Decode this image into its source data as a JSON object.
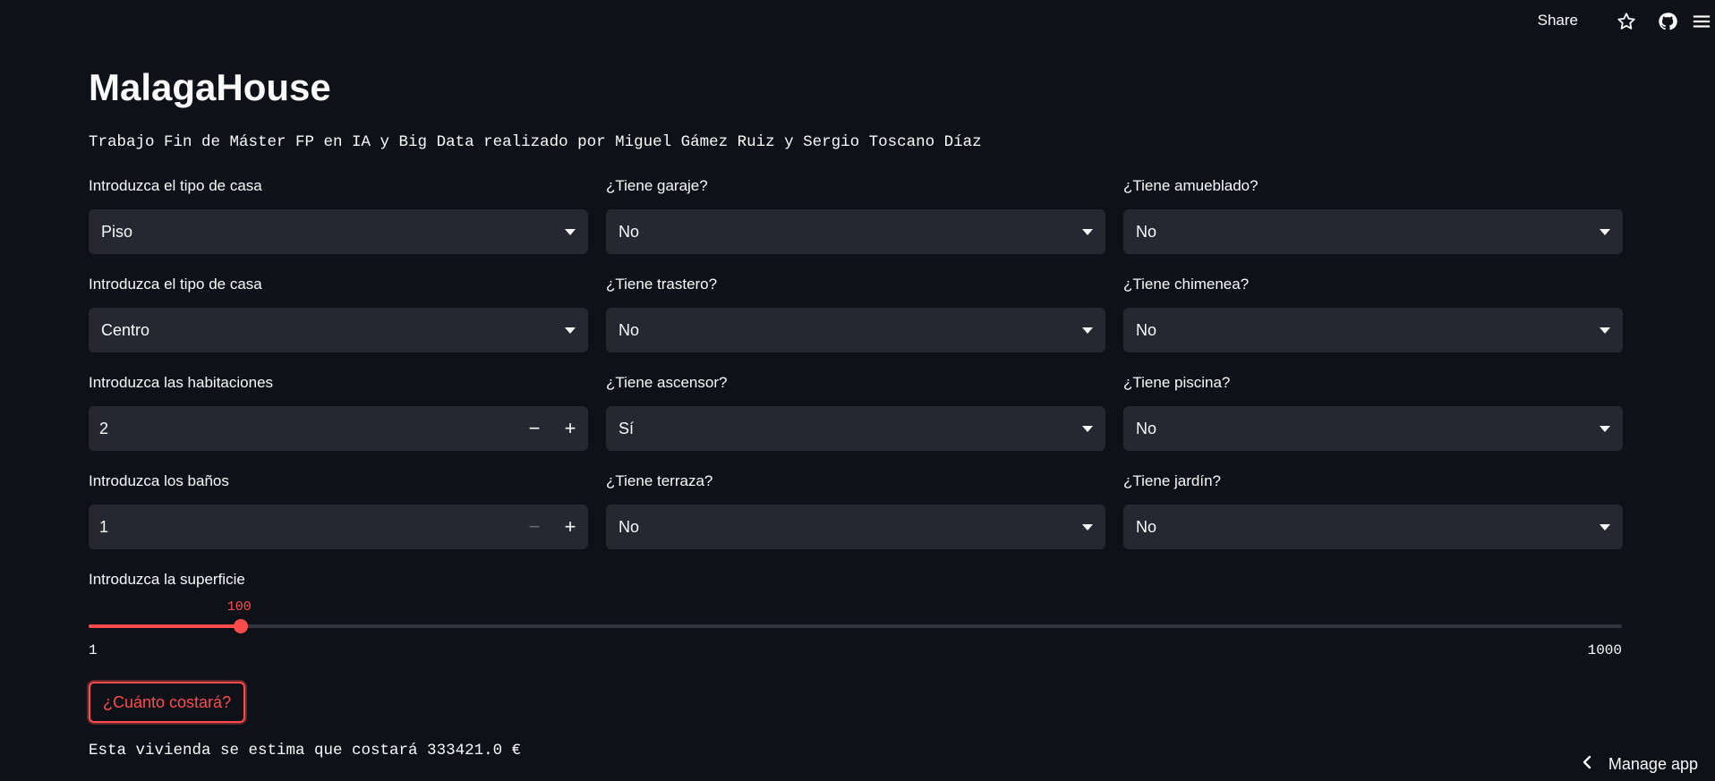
{
  "header": {
    "share_label": "Share",
    "icons": [
      "star-icon",
      "github-icon",
      "menu-icon"
    ]
  },
  "title": "MalagaHouse",
  "subtitle": "Trabajo Fin de Máster FP en IA y Big Data realizado por Miguel Gámez Ruiz y Sergio Toscano Díaz",
  "col1": {
    "tipo_casa": {
      "label": "Introduzca el tipo de casa",
      "value": "Piso"
    },
    "zona": {
      "label": "Introduzca el tipo de casa",
      "value": "Centro"
    },
    "habitaciones": {
      "label": "Introduzca las habitaciones",
      "value": "2"
    },
    "banos": {
      "label": "Introduzca los baños",
      "value": "1"
    }
  },
  "col2": {
    "garaje": {
      "label": "¿Tiene garaje?",
      "value": "No"
    },
    "trastero": {
      "label": "¿Tiene trastero?",
      "value": "No"
    },
    "ascensor": {
      "label": "¿Tiene ascensor?",
      "value": "Sí"
    },
    "terraza": {
      "label": "¿Tiene terraza?",
      "value": "No"
    }
  },
  "col3": {
    "amueblado": {
      "label": "¿Tiene amueblado?",
      "value": "No"
    },
    "chimenea": {
      "label": "¿Tiene chimenea?",
      "value": "No"
    },
    "piscina": {
      "label": "¿Tiene piscina?",
      "value": "No"
    },
    "jardin": {
      "label": "¿Tiene jardín?",
      "value": "No"
    }
  },
  "superficie": {
    "label": "Introduzca la superficie",
    "value": 100,
    "value_label": "100",
    "min": 1,
    "max": 1000,
    "min_label": "1",
    "max_label": "1000"
  },
  "submit_label": "¿Cuánto costará?",
  "result": "Esta vivienda se estima que costará 333421.0 €",
  "manage_label": "Manage app",
  "colors": {
    "accent": "#ff4b4b",
    "background": "#0e1117",
    "widget": "#262730"
  }
}
